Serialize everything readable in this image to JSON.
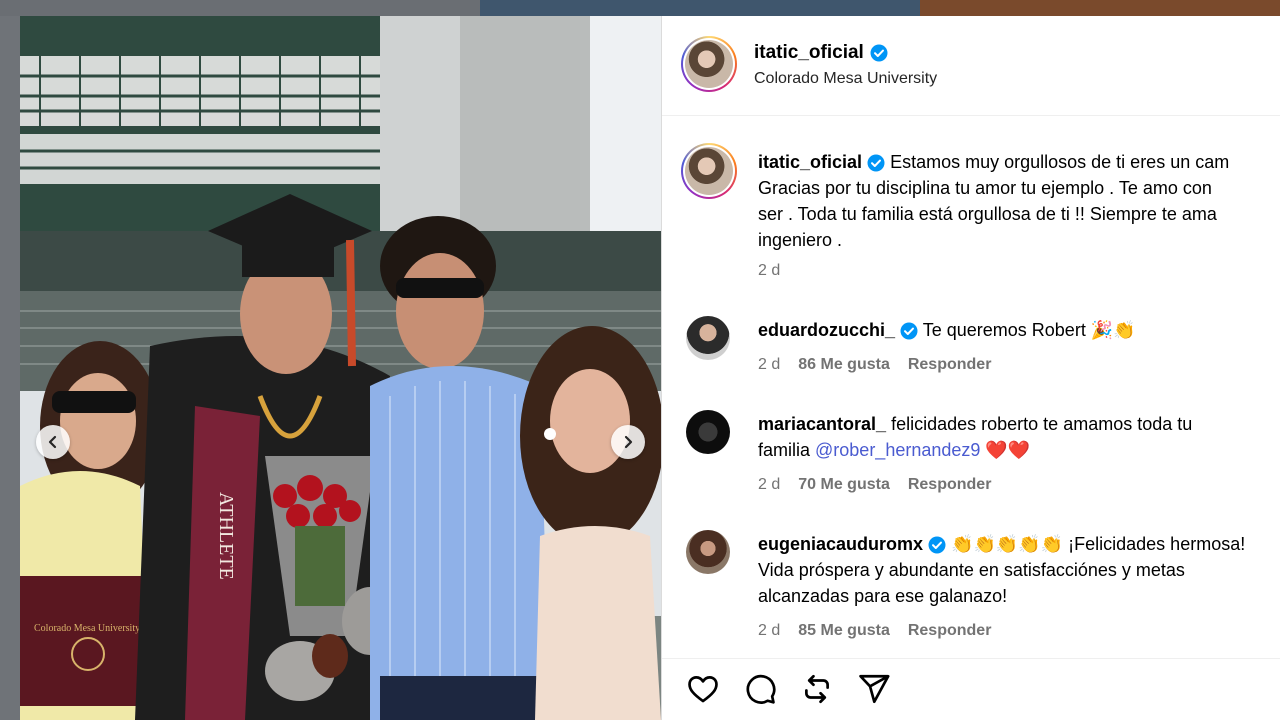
{
  "post": {
    "username": "itatic_oficial",
    "location": "Colorado Mesa University",
    "caption_username": "itatic_oficial",
    "caption_lines": [
      "Estamos muy orgullosos de ti eres un cam",
      "Gracias por tu disciplina tu amor tu ejemplo . Te amo con",
      "ser . Toda tu familia está orgullosa de ti !! Siempre te ama",
      "ingeniero ."
    ],
    "caption_time": "2 d"
  },
  "photo": {
    "diploma_text": "Colorado Mesa University",
    "stole_text": "ATHLETE"
  },
  "comments": [
    {
      "username": "eduardozucchi_",
      "verified": true,
      "text_lines": [
        "Te queremos Robert 🎉👏"
      ],
      "time": "2 d",
      "likes": "86 Me gusta",
      "reply": "Responder"
    },
    {
      "username": "mariacantoral_",
      "verified": false,
      "text_line1": "felicidades roberto te amamos toda tu",
      "text_line2_prefix": "familia ",
      "mention": "@rober_hernandez9",
      "text_line2_suffix": " ❤️❤️",
      "time": "2 d",
      "likes": "70 Me gusta",
      "reply": "Responder"
    },
    {
      "username": "eugeniacauduromx",
      "verified": true,
      "text_lines": [
        "👏👏👏👏👏 ¡Felicidades hermosa!",
        "Vida próspera y abundante en satisfacciónes y metas",
        "alcanzadas para ese galanazo!"
      ],
      "time": "2 d",
      "likes": "85 Me gusta",
      "reply": "Responder"
    }
  ],
  "colors": {
    "verified": "#0095f6",
    "mention": "#4a5bd0",
    "meta": "#737373"
  },
  "icons": [
    "heart-icon",
    "comment-icon",
    "repost-icon",
    "share-icon",
    "chevron-left-icon",
    "chevron-right-icon",
    "verified-icon"
  ]
}
